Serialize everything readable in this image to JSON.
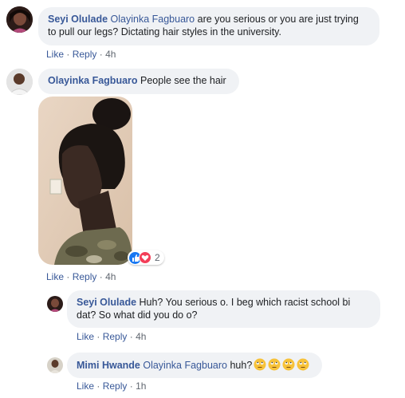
{
  "comments": [
    {
      "author": "Seyi Olulade",
      "mention": "Olayinka Fagbuaro",
      "text_line1": " are you serious or you are just trying",
      "text_line2": "to pull our legs? Dictating hair styles in the university.",
      "like": "Like",
      "reply": "Reply",
      "sep": "·",
      "time": "4h"
    },
    {
      "author": "Olayinka Fagbuaro",
      "text": " People see the hair",
      "like": "Like",
      "reply": "Reply",
      "sep": "·",
      "time": "4h",
      "reaction_count": "2"
    }
  ],
  "replies": [
    {
      "author": "Seyi Olulade",
      "text_line1": " Huh? You serious o. I beg which racist school bi",
      "text_line2": "dat? So what did you do o?",
      "like": "Like",
      "reply": "Reply",
      "sep": "·",
      "time": "4h"
    },
    {
      "author": "Mimi Hwande",
      "mention": "Olayinka Fagbuaro",
      "text": " huh?",
      "like": "Like",
      "reply": "Reply",
      "sep": "·",
      "time": "1h"
    }
  ],
  "colors": {
    "link": "#385898",
    "bubble": "#f0f2f5",
    "like_blue": "#1877f2",
    "love_red": "#f33e58"
  },
  "icons": [
    "like-reaction-icon",
    "love-reaction-icon",
    "eye-roll-emoji-icon"
  ]
}
